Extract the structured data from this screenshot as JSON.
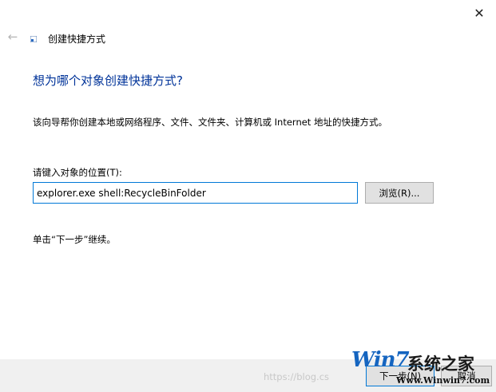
{
  "dialog": {
    "close_glyph": "✕",
    "back_glyph": "←",
    "title": "创建快捷方式"
  },
  "main": {
    "heading": "想为哪个对象创建快捷方式?",
    "description": "该向导帮你创建本地或网络程序、文件、文件夹、计算机或 Internet 地址的快捷方式。",
    "location_label": "请键入对象的位置(T):",
    "location_value": "explorer.exe shell:RecycleBinFolder",
    "browse_label": "浏览(R)...",
    "hint": "单击“下一步”继续。"
  },
  "footer": {
    "next_label": "下一步(N)",
    "cancel_label": "取消",
    "watermark": "https://blog.cs"
  },
  "logo": {
    "win": "Win7",
    "cn": "系统之家",
    "url": "Www.Winwin7.com"
  },
  "colors": {
    "heading": "#003399",
    "accent": "#0078d7",
    "footer_bg": "#f0f0f0"
  }
}
